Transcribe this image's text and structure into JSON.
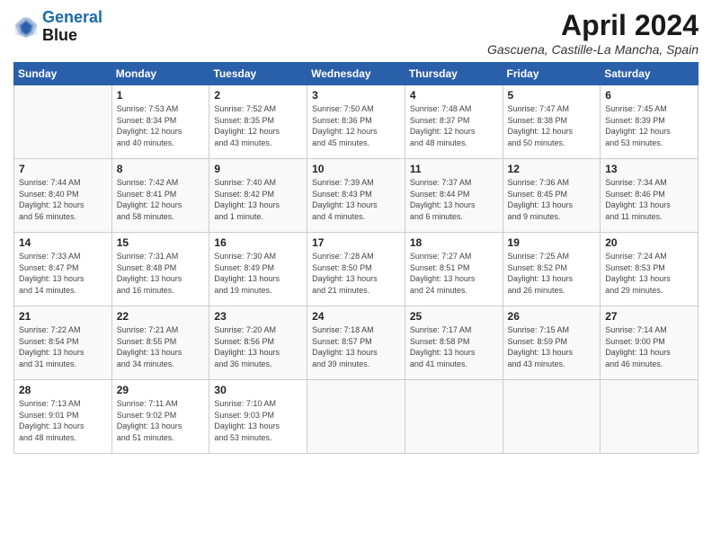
{
  "header": {
    "logo_line1": "General",
    "logo_line2": "Blue",
    "title": "April 2024",
    "location": "Gascuena, Castille-La Mancha, Spain"
  },
  "weekdays": [
    "Sunday",
    "Monday",
    "Tuesday",
    "Wednesday",
    "Thursday",
    "Friday",
    "Saturday"
  ],
  "weeks": [
    [
      {
        "day": "",
        "info": ""
      },
      {
        "day": "1",
        "info": "Sunrise: 7:53 AM\nSunset: 8:34 PM\nDaylight: 12 hours\nand 40 minutes."
      },
      {
        "day": "2",
        "info": "Sunrise: 7:52 AM\nSunset: 8:35 PM\nDaylight: 12 hours\nand 43 minutes."
      },
      {
        "day": "3",
        "info": "Sunrise: 7:50 AM\nSunset: 8:36 PM\nDaylight: 12 hours\nand 45 minutes."
      },
      {
        "day": "4",
        "info": "Sunrise: 7:48 AM\nSunset: 8:37 PM\nDaylight: 12 hours\nand 48 minutes."
      },
      {
        "day": "5",
        "info": "Sunrise: 7:47 AM\nSunset: 8:38 PM\nDaylight: 12 hours\nand 50 minutes."
      },
      {
        "day": "6",
        "info": "Sunrise: 7:45 AM\nSunset: 8:39 PM\nDaylight: 12 hours\nand 53 minutes."
      }
    ],
    [
      {
        "day": "7",
        "info": "Sunrise: 7:44 AM\nSunset: 8:40 PM\nDaylight: 12 hours\nand 56 minutes."
      },
      {
        "day": "8",
        "info": "Sunrise: 7:42 AM\nSunset: 8:41 PM\nDaylight: 12 hours\nand 58 minutes."
      },
      {
        "day": "9",
        "info": "Sunrise: 7:40 AM\nSunset: 8:42 PM\nDaylight: 13 hours\nand 1 minute."
      },
      {
        "day": "10",
        "info": "Sunrise: 7:39 AM\nSunset: 8:43 PM\nDaylight: 13 hours\nand 4 minutes."
      },
      {
        "day": "11",
        "info": "Sunrise: 7:37 AM\nSunset: 8:44 PM\nDaylight: 13 hours\nand 6 minutes."
      },
      {
        "day": "12",
        "info": "Sunrise: 7:36 AM\nSunset: 8:45 PM\nDaylight: 13 hours\nand 9 minutes."
      },
      {
        "day": "13",
        "info": "Sunrise: 7:34 AM\nSunset: 8:46 PM\nDaylight: 13 hours\nand 11 minutes."
      }
    ],
    [
      {
        "day": "14",
        "info": "Sunrise: 7:33 AM\nSunset: 8:47 PM\nDaylight: 13 hours\nand 14 minutes."
      },
      {
        "day": "15",
        "info": "Sunrise: 7:31 AM\nSunset: 8:48 PM\nDaylight: 13 hours\nand 16 minutes."
      },
      {
        "day": "16",
        "info": "Sunrise: 7:30 AM\nSunset: 8:49 PM\nDaylight: 13 hours\nand 19 minutes."
      },
      {
        "day": "17",
        "info": "Sunrise: 7:28 AM\nSunset: 8:50 PM\nDaylight: 13 hours\nand 21 minutes."
      },
      {
        "day": "18",
        "info": "Sunrise: 7:27 AM\nSunset: 8:51 PM\nDaylight: 13 hours\nand 24 minutes."
      },
      {
        "day": "19",
        "info": "Sunrise: 7:25 AM\nSunset: 8:52 PM\nDaylight: 13 hours\nand 26 minutes."
      },
      {
        "day": "20",
        "info": "Sunrise: 7:24 AM\nSunset: 8:53 PM\nDaylight: 13 hours\nand 29 minutes."
      }
    ],
    [
      {
        "day": "21",
        "info": "Sunrise: 7:22 AM\nSunset: 8:54 PM\nDaylight: 13 hours\nand 31 minutes."
      },
      {
        "day": "22",
        "info": "Sunrise: 7:21 AM\nSunset: 8:55 PM\nDaylight: 13 hours\nand 34 minutes."
      },
      {
        "day": "23",
        "info": "Sunrise: 7:20 AM\nSunset: 8:56 PM\nDaylight: 13 hours\nand 36 minutes."
      },
      {
        "day": "24",
        "info": "Sunrise: 7:18 AM\nSunset: 8:57 PM\nDaylight: 13 hours\nand 39 minutes."
      },
      {
        "day": "25",
        "info": "Sunrise: 7:17 AM\nSunset: 8:58 PM\nDaylight: 13 hours\nand 41 minutes."
      },
      {
        "day": "26",
        "info": "Sunrise: 7:15 AM\nSunset: 8:59 PM\nDaylight: 13 hours\nand 43 minutes."
      },
      {
        "day": "27",
        "info": "Sunrise: 7:14 AM\nSunset: 9:00 PM\nDaylight: 13 hours\nand 46 minutes."
      }
    ],
    [
      {
        "day": "28",
        "info": "Sunrise: 7:13 AM\nSunset: 9:01 PM\nDaylight: 13 hours\nand 48 minutes."
      },
      {
        "day": "29",
        "info": "Sunrise: 7:11 AM\nSunset: 9:02 PM\nDaylight: 13 hours\nand 51 minutes."
      },
      {
        "day": "30",
        "info": "Sunrise: 7:10 AM\nSunset: 9:03 PM\nDaylight: 13 hours\nand 53 minutes."
      },
      {
        "day": "",
        "info": ""
      },
      {
        "day": "",
        "info": ""
      },
      {
        "day": "",
        "info": ""
      },
      {
        "day": "",
        "info": ""
      }
    ]
  ]
}
